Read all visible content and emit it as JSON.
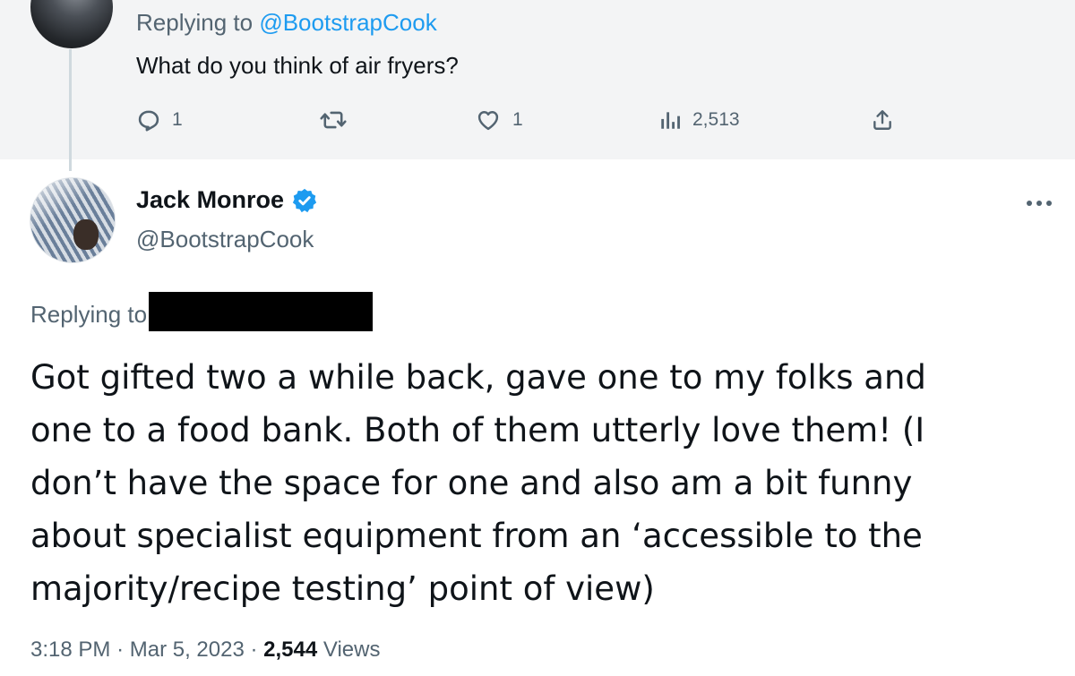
{
  "parent_tweet": {
    "replying_prefix": "Replying to ",
    "replying_handle": "@BootstrapCook",
    "text": "What do you think of air fryers?",
    "actions": {
      "reply_count": "1",
      "retweet_count": "",
      "like_count": "1",
      "views_count": "2,513"
    }
  },
  "main_tweet": {
    "display_name": "Jack Monroe",
    "handle": "@BootstrapCook",
    "replying_label": "Replying to",
    "body_lines": [
      "Got gifted two a while back, gave one to my folks and",
      "one to a food bank. Both of them utterly love them! (I",
      "don’t have the space for one and also am a bit funny",
      "about specialist equipment from an ‘accessible to the",
      "majority/recipe testing’ point of view)"
    ],
    "time": "3:18 PM",
    "separator": "·",
    "date": "Mar 5, 2023",
    "views": "2,544",
    "views_label": "Views"
  },
  "icons": {
    "reply": "reply-icon",
    "retweet": "retweet-icon",
    "like": "heart-icon",
    "analytics": "analytics-icon",
    "share": "share-icon",
    "verified": "verified-badge-icon",
    "more": "more-options-icon"
  },
  "colors": {
    "accent": "#1d9bf0",
    "secondary_text": "#536471",
    "primary_text": "#0f1419",
    "parent_background": "#f3f4f5"
  }
}
